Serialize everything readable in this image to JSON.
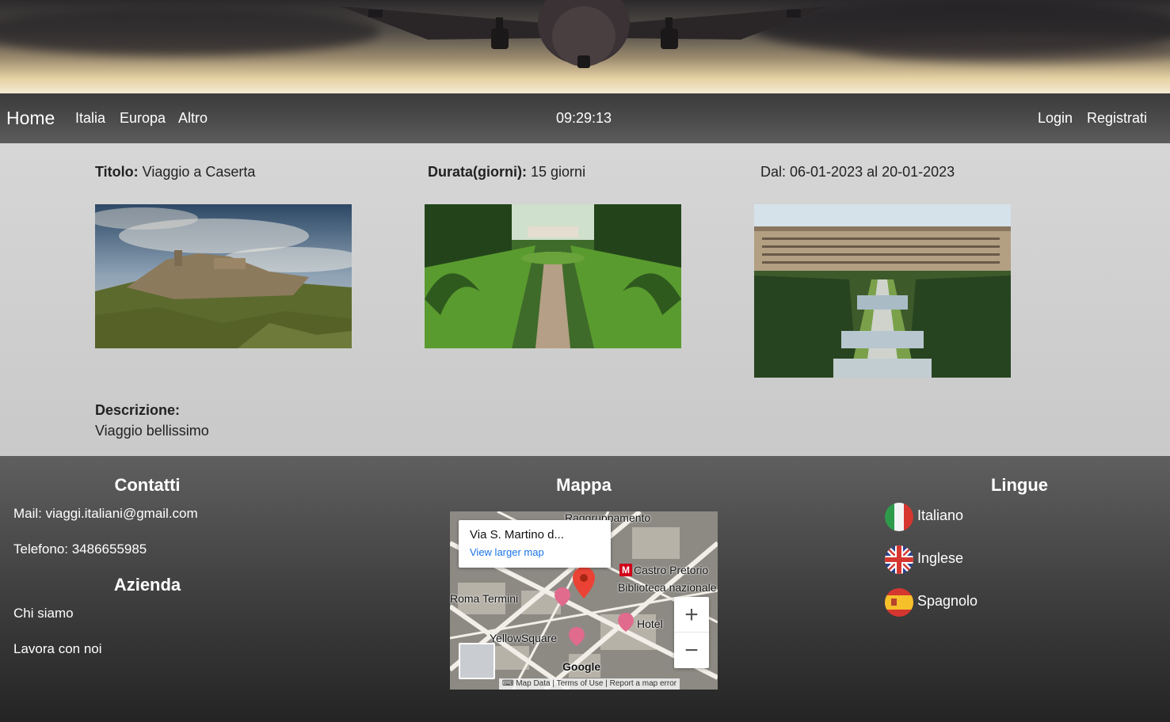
{
  "nav": {
    "home": "Home",
    "links": [
      "Italia",
      "Europa",
      "Altro"
    ],
    "clock": "09:29:13",
    "login": "Login",
    "register": "Registrati"
  },
  "trip": {
    "title_label": "Titolo:",
    "title_value": "Viaggio a Caserta",
    "duration_label": "Durata(giorni):",
    "duration_value": "15 giorni",
    "dates": "Dal: 06-01-2023 al 20-01-2023",
    "description_label": "Descrizione:",
    "description_value": "Viaggio bellissimo"
  },
  "footer": {
    "contacts_title": "Contatti",
    "mail": "Mail: viaggi.italiani@gmail.com",
    "phone": "Telefono: 3486655985",
    "company_title": "Azienda",
    "about": "Chi siamo",
    "jobs": "Lavora con noi",
    "map_title": "Mappa",
    "languages_title": "Lingue",
    "languages": [
      "Italiano",
      "Inglese",
      "Spagnolo"
    ]
  },
  "map": {
    "popup_address": "Via S. Martino d...",
    "popup_link": "View larger map",
    "labels": [
      "Raggruppamento",
      "Castro Pretorio",
      "Biblioteca nazionale",
      "Hotel",
      "Roma Termini",
      "YellowSquare",
      "Google"
    ],
    "zoom_in": "+",
    "zoom_out": "−",
    "attribution": [
      "Map Data",
      "Terms of Use",
      "Report a map error"
    ]
  },
  "colors": {
    "navbar": "#4a4a4a",
    "content_bg": "#cfcfcf",
    "footer_bg": "#3d3d3d",
    "link_blue": "#1a73e8",
    "marker_red": "#ea4335"
  },
  "icons": [
    "airplane-banner",
    "map-marker-icon",
    "italy-flag-icon",
    "uk-flag-icon",
    "spain-flag-icon"
  ]
}
